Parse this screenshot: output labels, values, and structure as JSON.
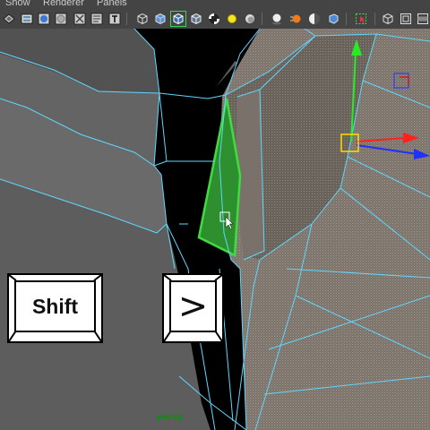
{
  "menu": {
    "items": [
      "Show",
      "Renderer",
      "Panels"
    ]
  },
  "toolbar": {
    "buttons": [
      {
        "icon": "select-camera-icon"
      },
      {
        "icon": "camera-attributes-icon"
      },
      {
        "icon": "image-plane-icon"
      },
      {
        "icon": "grease-pencil-icon"
      },
      {
        "icon": "bookmark-icon"
      },
      {
        "icon": "text-icon",
        "label": "T"
      },
      {
        "icon": "wireframe-cube-icon"
      },
      {
        "icon": "smooth-shade-cube-icon"
      },
      {
        "icon": "wireframe-on-shaded-icon",
        "active": true
      },
      {
        "icon": "xray-icon"
      },
      {
        "icon": "textured-checker-icon"
      },
      {
        "icon": "use-all-lights-icon"
      },
      {
        "icon": "shadows-icon"
      },
      {
        "icon": "screen-space-ao-icon"
      },
      {
        "icon": "motion-blur-icon"
      },
      {
        "icon": "depth-of-field-icon"
      },
      {
        "icon": "isolate-select-icon"
      },
      {
        "icon": "xray-joints-icon"
      },
      {
        "icon": "xray-active-component-icon"
      },
      {
        "icon": "resolution-gate-icon"
      }
    ]
  },
  "viewport": {
    "camera_label": "persp",
    "wire_color": "#5fd7ff",
    "selected_face_color": "#3fdc3f",
    "mesh_color": "#8a8077",
    "background_color": "#000000"
  },
  "keys": {
    "shift_label": "Shift",
    "greater_than_label": ">"
  },
  "manipulator": {
    "x_axis_color": "#ff2020",
    "y_axis_color": "#22ee22",
    "z_axis_color": "#2030ff",
    "center_color": "#ffdd00"
  }
}
